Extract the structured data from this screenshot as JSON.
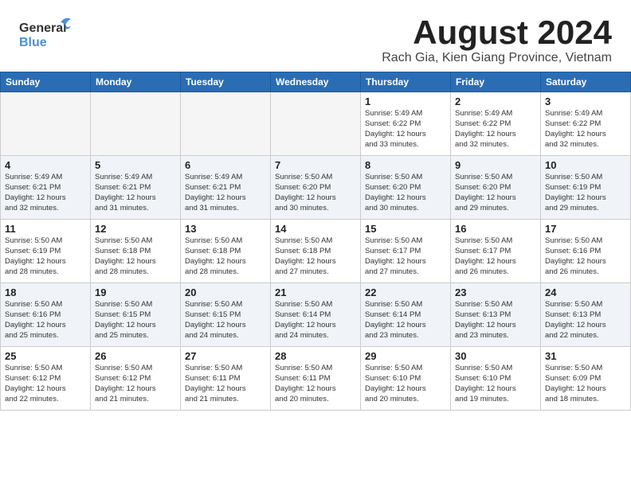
{
  "header": {
    "logo_line1": "General",
    "logo_line2": "Blue",
    "month": "August 2024",
    "location": "Rach Gia, Kien Giang Province, Vietnam"
  },
  "days_of_week": [
    "Sunday",
    "Monday",
    "Tuesday",
    "Wednesday",
    "Thursday",
    "Friday",
    "Saturday"
  ],
  "weeks": [
    [
      {
        "day": "",
        "info": ""
      },
      {
        "day": "",
        "info": ""
      },
      {
        "day": "",
        "info": ""
      },
      {
        "day": "",
        "info": ""
      },
      {
        "day": "1",
        "info": "Sunrise: 5:49 AM\nSunset: 6:22 PM\nDaylight: 12 hours\nand 33 minutes."
      },
      {
        "day": "2",
        "info": "Sunrise: 5:49 AM\nSunset: 6:22 PM\nDaylight: 12 hours\nand 32 minutes."
      },
      {
        "day": "3",
        "info": "Sunrise: 5:49 AM\nSunset: 6:22 PM\nDaylight: 12 hours\nand 32 minutes."
      }
    ],
    [
      {
        "day": "4",
        "info": "Sunrise: 5:49 AM\nSunset: 6:21 PM\nDaylight: 12 hours\nand 32 minutes."
      },
      {
        "day": "5",
        "info": "Sunrise: 5:49 AM\nSunset: 6:21 PM\nDaylight: 12 hours\nand 31 minutes."
      },
      {
        "day": "6",
        "info": "Sunrise: 5:49 AM\nSunset: 6:21 PM\nDaylight: 12 hours\nand 31 minutes."
      },
      {
        "day": "7",
        "info": "Sunrise: 5:50 AM\nSunset: 6:20 PM\nDaylight: 12 hours\nand 30 minutes."
      },
      {
        "day": "8",
        "info": "Sunrise: 5:50 AM\nSunset: 6:20 PM\nDaylight: 12 hours\nand 30 minutes."
      },
      {
        "day": "9",
        "info": "Sunrise: 5:50 AM\nSunset: 6:20 PM\nDaylight: 12 hours\nand 29 minutes."
      },
      {
        "day": "10",
        "info": "Sunrise: 5:50 AM\nSunset: 6:19 PM\nDaylight: 12 hours\nand 29 minutes."
      }
    ],
    [
      {
        "day": "11",
        "info": "Sunrise: 5:50 AM\nSunset: 6:19 PM\nDaylight: 12 hours\nand 28 minutes."
      },
      {
        "day": "12",
        "info": "Sunrise: 5:50 AM\nSunset: 6:18 PM\nDaylight: 12 hours\nand 28 minutes."
      },
      {
        "day": "13",
        "info": "Sunrise: 5:50 AM\nSunset: 6:18 PM\nDaylight: 12 hours\nand 28 minutes."
      },
      {
        "day": "14",
        "info": "Sunrise: 5:50 AM\nSunset: 6:18 PM\nDaylight: 12 hours\nand 27 minutes."
      },
      {
        "day": "15",
        "info": "Sunrise: 5:50 AM\nSunset: 6:17 PM\nDaylight: 12 hours\nand 27 minutes."
      },
      {
        "day": "16",
        "info": "Sunrise: 5:50 AM\nSunset: 6:17 PM\nDaylight: 12 hours\nand 26 minutes."
      },
      {
        "day": "17",
        "info": "Sunrise: 5:50 AM\nSunset: 6:16 PM\nDaylight: 12 hours\nand 26 minutes."
      }
    ],
    [
      {
        "day": "18",
        "info": "Sunrise: 5:50 AM\nSunset: 6:16 PM\nDaylight: 12 hours\nand 25 minutes."
      },
      {
        "day": "19",
        "info": "Sunrise: 5:50 AM\nSunset: 6:15 PM\nDaylight: 12 hours\nand 25 minutes."
      },
      {
        "day": "20",
        "info": "Sunrise: 5:50 AM\nSunset: 6:15 PM\nDaylight: 12 hours\nand 24 minutes."
      },
      {
        "day": "21",
        "info": "Sunrise: 5:50 AM\nSunset: 6:14 PM\nDaylight: 12 hours\nand 24 minutes."
      },
      {
        "day": "22",
        "info": "Sunrise: 5:50 AM\nSunset: 6:14 PM\nDaylight: 12 hours\nand 23 minutes."
      },
      {
        "day": "23",
        "info": "Sunrise: 5:50 AM\nSunset: 6:13 PM\nDaylight: 12 hours\nand 23 minutes."
      },
      {
        "day": "24",
        "info": "Sunrise: 5:50 AM\nSunset: 6:13 PM\nDaylight: 12 hours\nand 22 minutes."
      }
    ],
    [
      {
        "day": "25",
        "info": "Sunrise: 5:50 AM\nSunset: 6:12 PM\nDaylight: 12 hours\nand 22 minutes."
      },
      {
        "day": "26",
        "info": "Sunrise: 5:50 AM\nSunset: 6:12 PM\nDaylight: 12 hours\nand 21 minutes."
      },
      {
        "day": "27",
        "info": "Sunrise: 5:50 AM\nSunset: 6:11 PM\nDaylight: 12 hours\nand 21 minutes."
      },
      {
        "day": "28",
        "info": "Sunrise: 5:50 AM\nSunset: 6:11 PM\nDaylight: 12 hours\nand 20 minutes."
      },
      {
        "day": "29",
        "info": "Sunrise: 5:50 AM\nSunset: 6:10 PM\nDaylight: 12 hours\nand 20 minutes."
      },
      {
        "day": "30",
        "info": "Sunrise: 5:50 AM\nSunset: 6:10 PM\nDaylight: 12 hours\nand 19 minutes."
      },
      {
        "day": "31",
        "info": "Sunrise: 5:50 AM\nSunset: 6:09 PM\nDaylight: 12 hours\nand 18 minutes."
      }
    ]
  ]
}
